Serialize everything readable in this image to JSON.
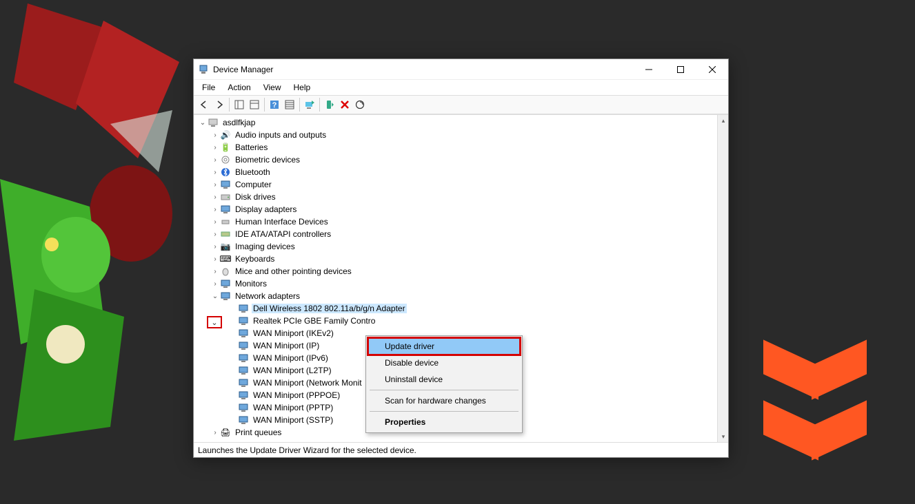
{
  "window": {
    "title": "Device Manager"
  },
  "menus": {
    "file": "File",
    "action": "Action",
    "view": "View",
    "help": "Help"
  },
  "tree": {
    "root": "asdlfkjap",
    "items": {
      "audio": "Audio inputs and outputs",
      "batteries": "Batteries",
      "biometric": "Biometric devices",
      "bluetooth": "Bluetooth",
      "computer": "Computer",
      "disk": "Disk drives",
      "display": "Display adapters",
      "hid": "Human Interface Devices",
      "ide": "IDE ATA/ATAPI controllers",
      "imaging": "Imaging devices",
      "keyboards": "Keyboards",
      "mice": "Mice and other pointing devices",
      "monitors": "Monitors",
      "network": "Network adapters",
      "print": "Print queues"
    },
    "network_children": {
      "dell": "Dell Wireless 1802 802.11a/b/g/n Adapter",
      "realtek": "Realtek PCIe GBE Family Contro",
      "wan_ikev2": "WAN Miniport (IKEv2)",
      "wan_ip": "WAN Miniport (IP)",
      "wan_ipv6": "WAN Miniport (IPv6)",
      "wan_l2tp": "WAN Miniport (L2TP)",
      "wan_netmon": "WAN Miniport (Network Monit",
      "wan_pppoe": "WAN Miniport (PPPOE)",
      "wan_pptp": "WAN Miniport (PPTP)",
      "wan_sstp": "WAN Miniport (SSTP)"
    }
  },
  "context_menu": {
    "update": "Update driver",
    "disable": "Disable device",
    "uninstall": "Uninstall device",
    "scan": "Scan for hardware changes",
    "properties": "Properties"
  },
  "statusbar": "Launches the Update Driver Wizard for the selected device."
}
